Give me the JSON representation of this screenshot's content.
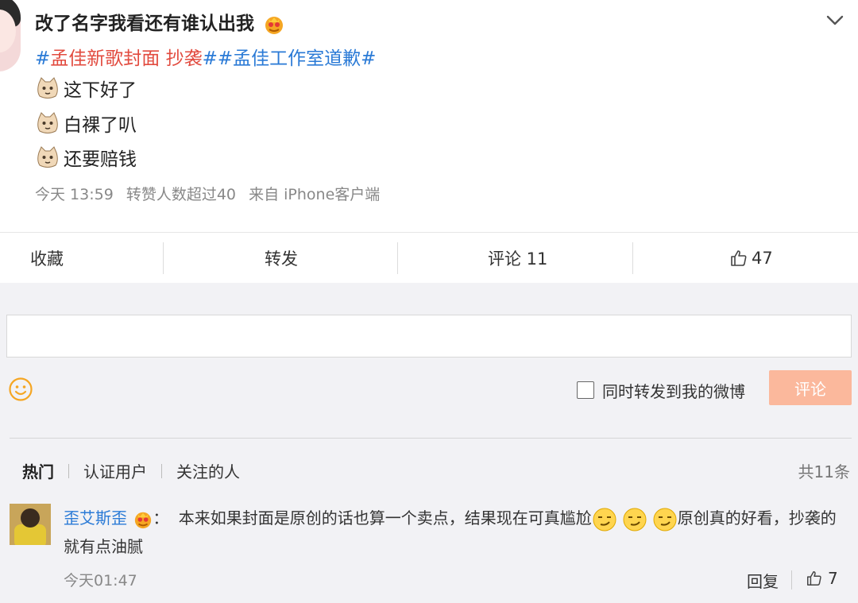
{
  "post": {
    "author": "改了名字我看还有谁认出我",
    "tags": {
      "tag1_prefix": "#",
      "tag1_red": "孟佳新歌封面 抄袭",
      "tag1_suffix": "##",
      "tag2_text": "孟佳工作室道歉",
      "tag2_suffix": "#"
    },
    "lines": [
      "这下好了",
      "白裸了叭",
      "还要赔钱"
    ],
    "meta": {
      "time": "今天 13:59",
      "likes_note": "转赞人数超过40",
      "source": "来自 iPhone客户端"
    }
  },
  "actions": {
    "favorite": "收藏",
    "repost": "转发",
    "comment": "评论 11",
    "like_count": "47"
  },
  "reply": {
    "checkbox_label": "同时转发到我的微博",
    "submit_label": "评论"
  },
  "filters": {
    "hot": "热门",
    "verified": "认证用户",
    "following": "关注的人",
    "total": "共11条"
  },
  "comments": [
    {
      "user": "歪艾斯歪",
      "colon": "：",
      "text_part1": "本来如果封面是原创的话也算一个卖点，结果现在可真尴尬",
      "text_part2": "原创真的好看，抄袭的就有点油腻",
      "time": "今天01:47",
      "reply_label": "回复",
      "likes": "7"
    }
  ],
  "colors": {
    "link_blue": "#2a7ad6",
    "tag_red": "#e24b3f",
    "button_orange": "#fbb89c"
  }
}
